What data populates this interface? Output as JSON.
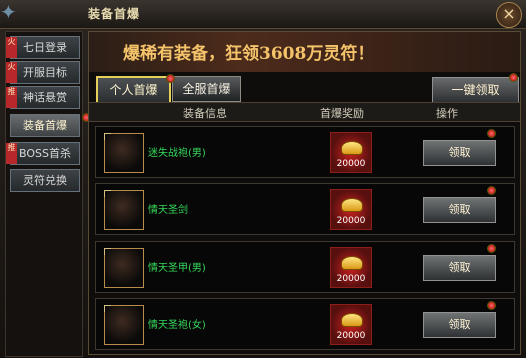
{
  "window": {
    "title": "装备首爆"
  },
  "sidebar": {
    "items": [
      {
        "label": "七日登录",
        "tag": "火"
      },
      {
        "label": "开服目标",
        "tag": "火"
      },
      {
        "label": "神话悬赏",
        "tag": "推"
      },
      {
        "label": "装备首爆",
        "tag": "",
        "active": true
      },
      {
        "label": "BOSS首杀",
        "tag": "推"
      },
      {
        "label": "灵符兑换",
        "tag": ""
      }
    ]
  },
  "banner": {
    "text": "爆稀有装备，狂领3608万灵符！"
  },
  "tabs": [
    {
      "label": "个人首爆",
      "active": true
    },
    {
      "label": "全服首爆",
      "active": false
    }
  ],
  "claim_all_label": "一键领取",
  "table": {
    "headers": [
      "装备信息",
      "首爆奖励",
      "操作"
    ],
    "rows": [
      {
        "name": "迷失战袍(男)",
        "reward": "20000",
        "button": "领取",
        "icon": "armor-gem-icon"
      },
      {
        "name": "情天圣剑",
        "reward": "20000",
        "button": "领取",
        "icon": "sword-icon"
      },
      {
        "name": "情天圣甲(男)",
        "reward": "20000",
        "button": "领取",
        "icon": "armor-icon"
      },
      {
        "name": "情天圣袍(女)",
        "reward": "20000",
        "button": "领取",
        "icon": "robe-icon"
      }
    ]
  },
  "colors": {
    "accent": "#e4cf5a",
    "badge": "#b8282a",
    "item_text": "#36d85b",
    "reward_bg": "#cc2220"
  }
}
